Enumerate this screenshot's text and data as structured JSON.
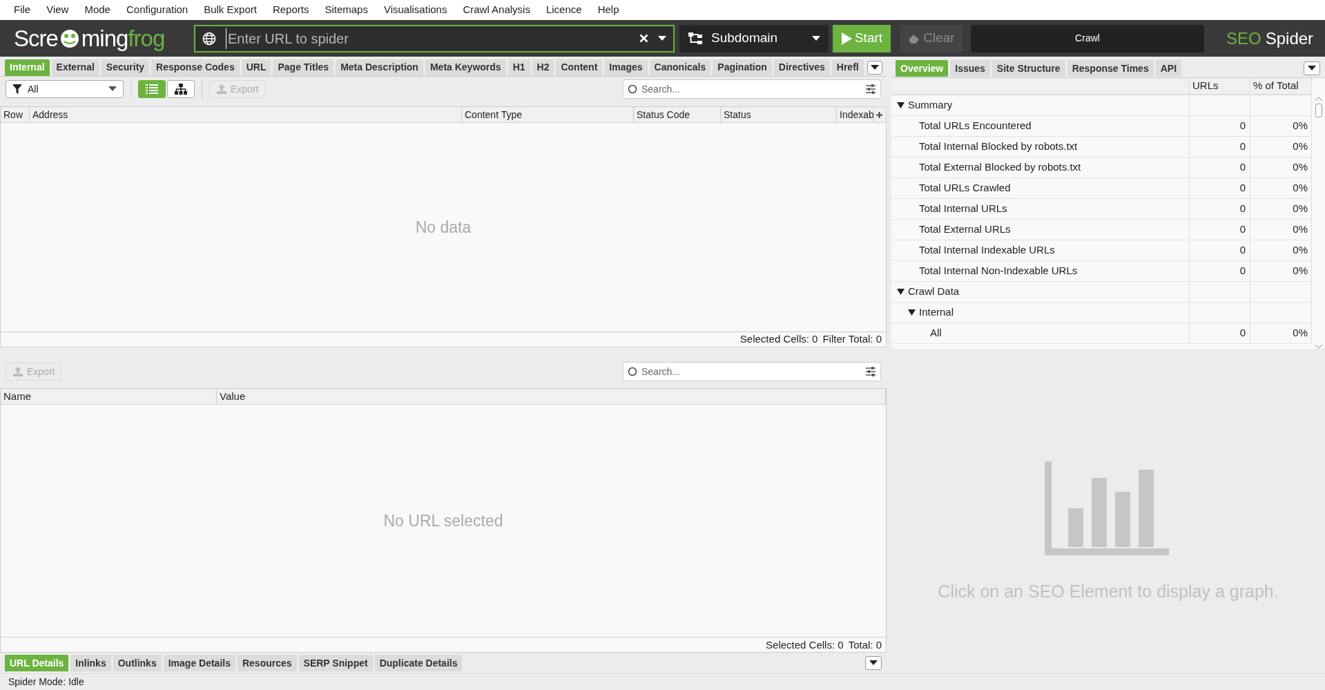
{
  "menu": [
    "File",
    "View",
    "Mode",
    "Configuration",
    "Bulk Export",
    "Reports",
    "Sitemaps",
    "Visualisations",
    "Crawl Analysis",
    "Licence",
    "Help"
  ],
  "toolbar": {
    "logo": {
      "start": "Scre",
      "middle": "ming",
      "end": "frog"
    },
    "url_field": {
      "placeholder": "Enter URL to spider"
    },
    "mode_dropdown": "Subdomain",
    "start_button": "Start",
    "clear_button": {
      "label": "Clear",
      "disabled": true
    },
    "progress": {
      "label": "Crawl",
      "level": 0
    },
    "product": {
      "accent": "SEO",
      "name": "Spider"
    }
  },
  "main_tabs": [
    {
      "label": "Internal",
      "selected": true
    },
    {
      "label": "External",
      "selected": false
    },
    {
      "label": "Security",
      "selected": false
    },
    {
      "label": "Response Codes",
      "selected": false
    },
    {
      "label": "URL",
      "selected": false
    },
    {
      "label": "Page Titles",
      "selected": false
    },
    {
      "label": "Meta Description",
      "selected": false
    },
    {
      "label": "Meta Keywords",
      "selected": false
    },
    {
      "label": "H1",
      "selected": false
    },
    {
      "label": "H2",
      "selected": false
    },
    {
      "label": "Content",
      "selected": false
    },
    {
      "label": "Images",
      "selected": false
    },
    {
      "label": "Canonicals",
      "selected": false
    },
    {
      "label": "Pagination",
      "selected": false
    },
    {
      "label": "Directives",
      "selected": false
    },
    {
      "label": "Hrefl",
      "selected": false
    }
  ],
  "filter": {
    "value": "All"
  },
  "view_toggle": [
    {
      "kind": "list",
      "selected": true
    },
    {
      "kind": "tree",
      "selected": false
    }
  ],
  "export_button": {
    "label": "Export",
    "disabled": true
  },
  "search": {
    "placeholder": "Search..."
  },
  "table": {
    "columns": [
      "Row",
      "Address",
      "Content Type",
      "Status Code",
      "Status",
      "Indexab"
    ],
    "empty_message": "No data",
    "footer": [
      "Selected Cells: 0",
      "Filter Total: 0"
    ]
  },
  "details": {
    "export_button": {
      "label": "Export",
      "disabled": true
    },
    "search": {
      "placeholder": "Search..."
    },
    "columns": [
      "Name",
      "Value"
    ],
    "empty_message": "No URL selected",
    "footer": [
      "Selected Cells: 0",
      "Total: 0"
    ]
  },
  "bottom_tabs": [
    {
      "label": "URL Details",
      "selected": true
    },
    {
      "label": "Inlinks",
      "selected": false
    },
    {
      "label": "Outlinks",
      "selected": false
    },
    {
      "label": "Image Details",
      "selected": false
    },
    {
      "label": "Resources",
      "selected": false
    },
    {
      "label": "SERP Snippet",
      "selected": false
    },
    {
      "label": "Duplicate Details",
      "selected": false
    }
  ],
  "overview": {
    "tabs": [
      {
        "label": "Overview",
        "selected": true
      },
      {
        "label": "Issues",
        "selected": false
      },
      {
        "label": "Site Structure",
        "selected": false
      },
      {
        "label": "Response Times",
        "selected": false
      },
      {
        "label": "API",
        "selected": false
      }
    ],
    "columns": [
      "URLs",
      "% of Total"
    ],
    "tree": [
      {
        "label": "Summary",
        "expanded": true,
        "children": [
          {
            "label": "Total URLs Encountered",
            "urls": "0",
            "percent": "0%"
          },
          {
            "label": "Total Internal Blocked by robots.txt",
            "urls": "0",
            "percent": "0%"
          },
          {
            "label": "Total External Blocked by robots.txt",
            "urls": "0",
            "percent": "0%"
          },
          {
            "label": "Total URLs Crawled",
            "urls": "0",
            "percent": "0%"
          },
          {
            "label": "Total Internal URLs",
            "urls": "0",
            "percent": "0%"
          },
          {
            "label": "Total External URLs",
            "urls": "0",
            "percent": "0%"
          },
          {
            "label": "Total Internal Indexable URLs",
            "urls": "0",
            "percent": "0%"
          },
          {
            "label": "Total Internal Non-Indexable URLs",
            "urls": "0",
            "percent": "0%"
          }
        ]
      },
      {
        "label": "Crawl Data",
        "expanded": true,
        "children": [
          {
            "label": "Internal",
            "expanded": true,
            "children": [
              {
                "label": "All",
                "urls": "0",
                "percent": "0%"
              }
            ]
          }
        ]
      }
    ]
  },
  "graph": {
    "message": "Click on an SEO Element to display a graph."
  },
  "status_bar": "Spider Mode: Idle"
}
